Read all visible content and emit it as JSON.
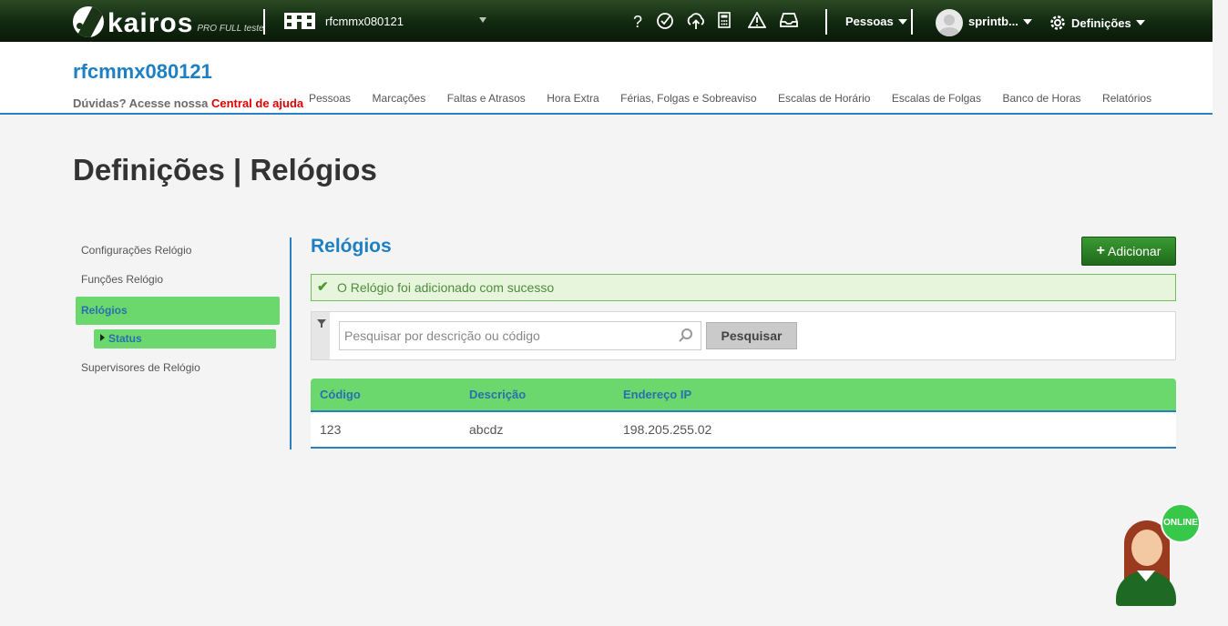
{
  "topbar": {
    "logo_text": "kairos",
    "logo_sub": "PRO FULL teste",
    "company_selector": "rfcmmx080121",
    "icons": [
      "help-icon",
      "clock-check-icon",
      "cloud-upload-icon",
      "calculator-icon",
      "warning-icon",
      "inbox-icon"
    ],
    "pessoas_menu": "Pessoas",
    "user_name": "sprintb...",
    "definicoes_menu": "Definições"
  },
  "header": {
    "company_title": "rfcmmx080121",
    "help_prefix": "Dúvidas? Acesse nossa",
    "help_link": "Central de ajuda",
    "nav": [
      "Pessoas",
      "Marcações",
      "Faltas e Atrasos",
      "Hora Extra",
      "Férias, Folgas e Sobreaviso",
      "Escalas de Horário",
      "Escalas de Folgas",
      "Banco de Horas",
      "Relatórios"
    ]
  },
  "page": {
    "title": "Definições | Relógios"
  },
  "sidebar": {
    "items": [
      "Configurações Relógio",
      "Funções Relógio",
      "Relógios"
    ],
    "sub_item": "Status",
    "last_item": "Supervisores de Relógio"
  },
  "content": {
    "section_title": "Relógios",
    "add_button": "Adicionar",
    "alert": "O Relógio foi adicionado com sucesso",
    "search_placeholder": "Pesquisar por descrição ou código",
    "search_button": "Pesquisar"
  },
  "table": {
    "headers": [
      "Código",
      "Descrição",
      "Endereço IP"
    ],
    "rows": [
      [
        "123",
        "abcdz",
        "198.205.255.02"
      ]
    ]
  },
  "agent": {
    "status_label": "ONLINE"
  }
}
